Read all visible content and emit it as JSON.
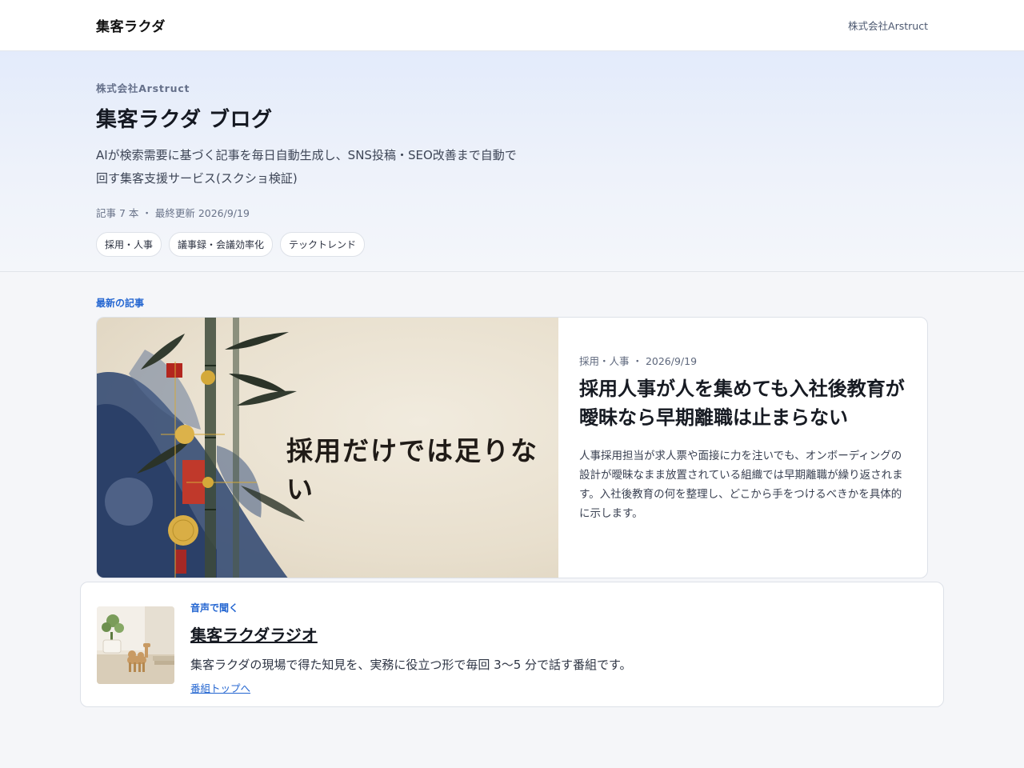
{
  "header": {
    "brand": "集客ラクダ",
    "company_link": "株式会社Arstruct"
  },
  "hero": {
    "company": "株式会社Arstruct",
    "title": "集客ラクダ ブログ",
    "description_line1": "AIが検索需要に基づく記事を毎日自動生成し、SNS投稿・SEO改善まで自動で",
    "description_line2": "回す集客支援サービス(スクショ検証)",
    "meta": "記事 7 本 ・ 最終更新 2026/9/19",
    "tags": [
      "採用・人事",
      "議事録・会議効率化",
      "テックトレンド"
    ]
  },
  "latest": {
    "section_label": "最新の記事",
    "featured": {
      "image_text": "採用だけでは足りない",
      "meta": "採用・人事 ・ 2026/9/19",
      "title": "採用人事が人を集めても入社後教育が曖昧なら早期離職は止まらない",
      "excerpt": "人事採用担当が求人票や面接に力を注いでも、オンボーディングの設計が曖昧なまま放置されている組織では早期離職が繰り返されます。入社後教育の何を整理し、どこから手をつけるべきかを具体的に示します。"
    }
  },
  "radio": {
    "label": "音声で聞く",
    "title": "集客ラクダラジオ",
    "description": "集客ラクダの現場で得た知見を、実務に役立つ形で毎回 3〜5 分で話す番組です。",
    "link": "番組トップへ"
  },
  "colors": {
    "accent": "#2466d1",
    "ink_blue": "#2c4470",
    "seal_red": "#b3261e",
    "gold": "#d4a93a"
  }
}
